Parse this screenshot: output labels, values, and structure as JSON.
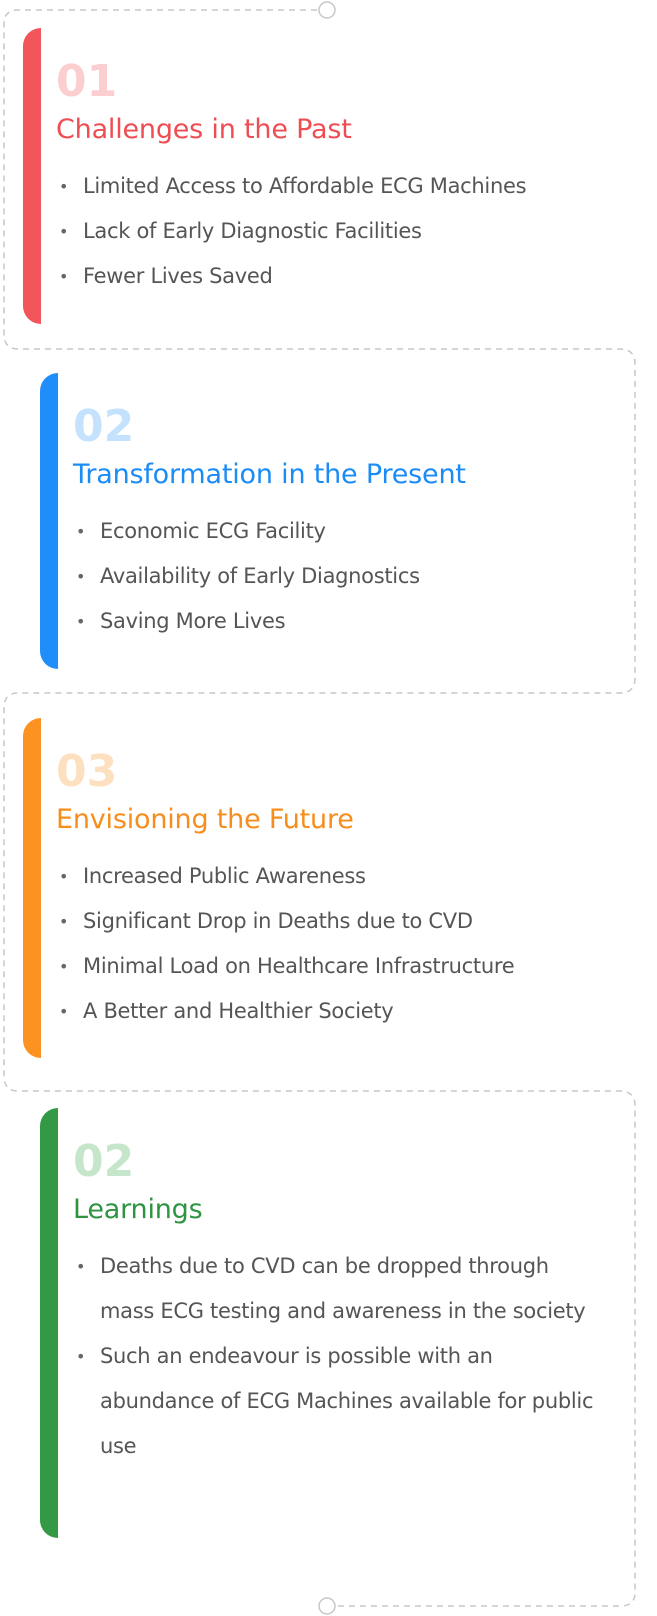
{
  "theme": {
    "border_color": "#c7c7c7",
    "text_color": "#555555"
  },
  "sections": [
    {
      "number": "01",
      "title": "Challenges in the Past",
      "accent": "#f2555a",
      "points": [
        "Limited Access to Affordable ECG Machines",
        "Lack of Early Diagnostic Facilities",
        "Fewer Lives Saved"
      ]
    },
    {
      "number": "02",
      "title": "Transformation in the Present",
      "accent": "#1f8efa",
      "points": [
        "Economic ECG Facility",
        "Availability of Early Diagnostics",
        "Saving More Lives"
      ]
    },
    {
      "number": "03",
      "title": "Envisioning the Future",
      "accent": "#fb9221",
      "points": [
        "Increased Public Awareness",
        "Significant Drop in Deaths due to CVD",
        "Minimal Load on Healthcare Infrastructure",
        "A Better and Healthier Society"
      ]
    },
    {
      "number": "02",
      "title": "Learnings",
      "accent": "#339944",
      "points": [
        "Deaths due to CVD can be dropped through mass ECG testing and awareness in the society",
        "Such an endeavour is possible with an abundance of ECG Machines available for public use"
      ]
    }
  ]
}
